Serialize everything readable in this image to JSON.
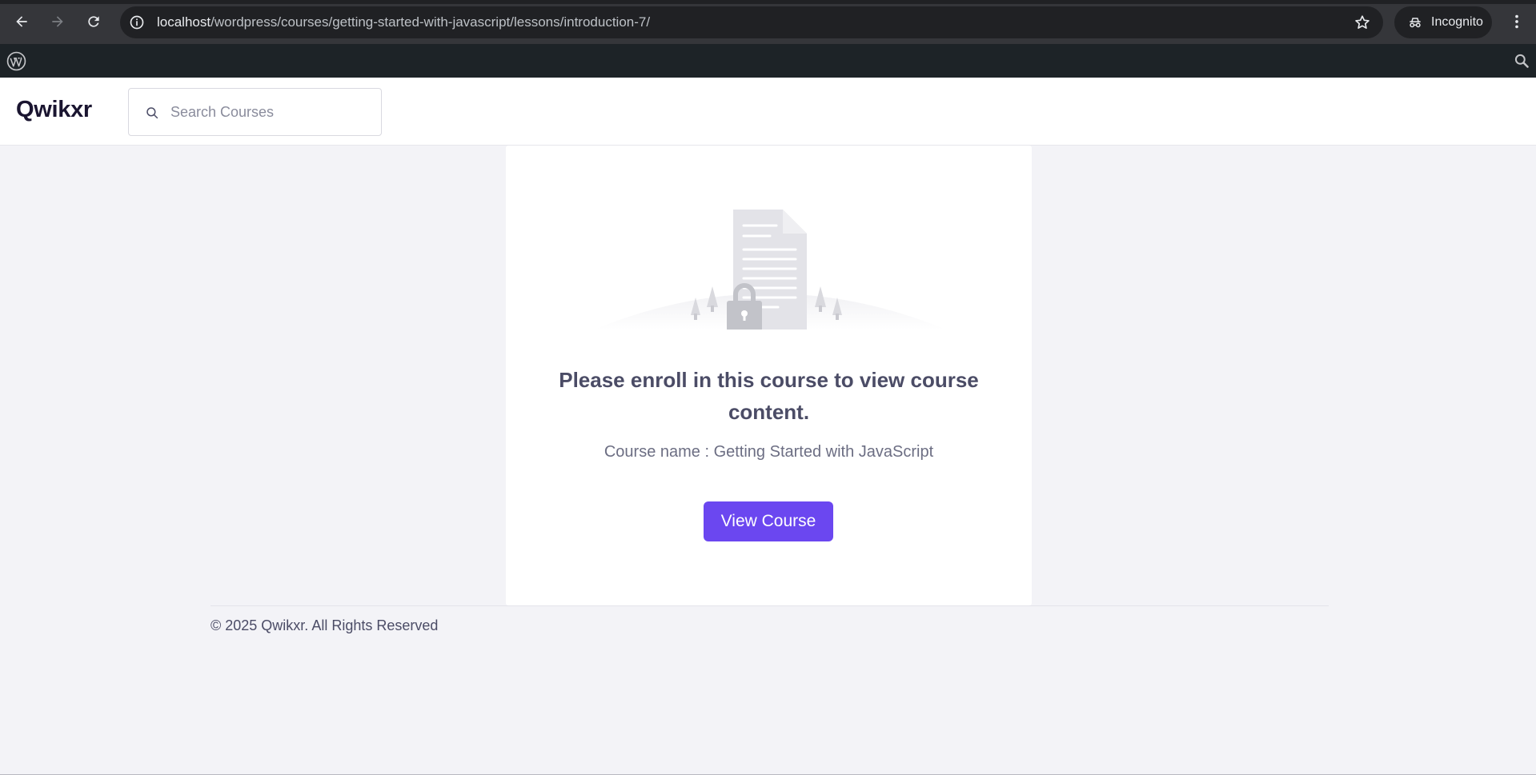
{
  "browser": {
    "url_host": "localhost",
    "url_path": "/wordpress/courses/getting-started-with-javascript/lessons/introduction-7/",
    "profile_label": "Incognito"
  },
  "header": {
    "logo": "Qwikxr",
    "search_placeholder": "Search Courses"
  },
  "main": {
    "heading": "Please enroll in this course to view course content.",
    "course_name": "Course name : Getting Started with JavaScript",
    "view_course_label": "View Course"
  },
  "footer": {
    "copyright": "© 2025 Qwikxr. All Rights Reserved"
  },
  "colors": {
    "accent": "#6b47f0",
    "wp_bar": "#1d2327",
    "page_bg": "#f3f3f7"
  },
  "icons": [
    "back-icon",
    "forward-icon",
    "reload-icon",
    "info-icon",
    "star-icon",
    "incognito-icon",
    "more-icon",
    "wordpress-icon",
    "search-icon",
    "locked-document-icon"
  ]
}
